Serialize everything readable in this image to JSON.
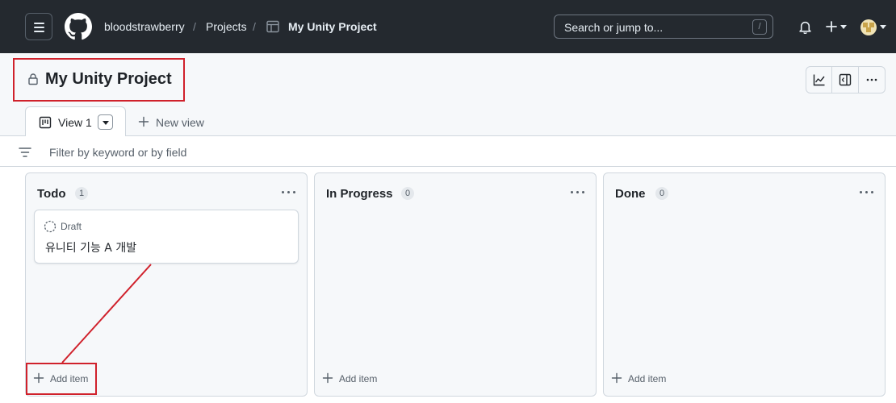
{
  "header": {
    "owner": "bloodstrawberry",
    "separator": "/",
    "projects_link": "Projects",
    "project_name": "My Unity Project",
    "search_placeholder": "Search or jump to...",
    "search_shortcut": "/"
  },
  "project": {
    "title": "My Unity Project",
    "toolbar_icons": [
      "insights-icon",
      "sidebar-icon",
      "more-options-icon"
    ]
  },
  "tabs": {
    "active_label": "View 1",
    "new_view_label": "New view"
  },
  "filter": {
    "placeholder": "Filter by keyword or by field"
  },
  "columns": [
    {
      "title": "Todo",
      "count": "1",
      "items": [
        {
          "status": "Draft",
          "title": "유니티 기능 A 개발"
        }
      ],
      "add_label": "Add item"
    },
    {
      "title": "In Progress",
      "count": "0",
      "items": [],
      "add_label": "Add item"
    },
    {
      "title": "Done",
      "count": "0",
      "items": [],
      "add_label": "Add item"
    }
  ],
  "colors": {
    "header_bg": "#24292f",
    "annotation_red": "#d0212b",
    "column_bg": "#f6f8fa",
    "border": "#d0d7de"
  }
}
